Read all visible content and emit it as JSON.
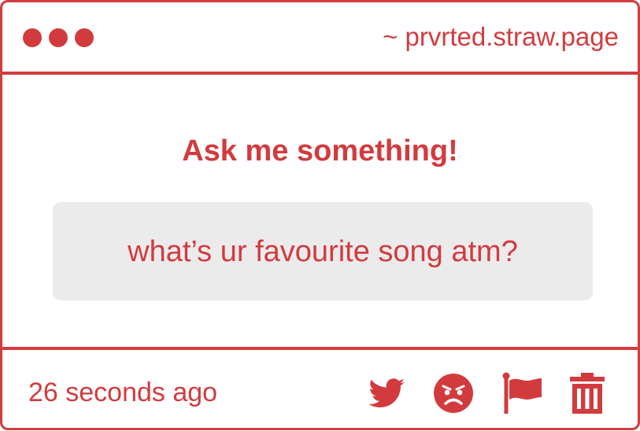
{
  "window": {
    "url": "~ prvrted.straw.page"
  },
  "main": {
    "prompt": "Ask me something!",
    "question": "what’s ur favourite song atm?"
  },
  "footer": {
    "timestamp": "26 seconds ago",
    "icons": [
      "twitter-icon",
      "angry-face-icon",
      "flag-icon",
      "trash-icon"
    ]
  },
  "colors": {
    "accent": "#d23b3e",
    "question_bg": "#ecebec",
    "background": "#ffffff"
  }
}
